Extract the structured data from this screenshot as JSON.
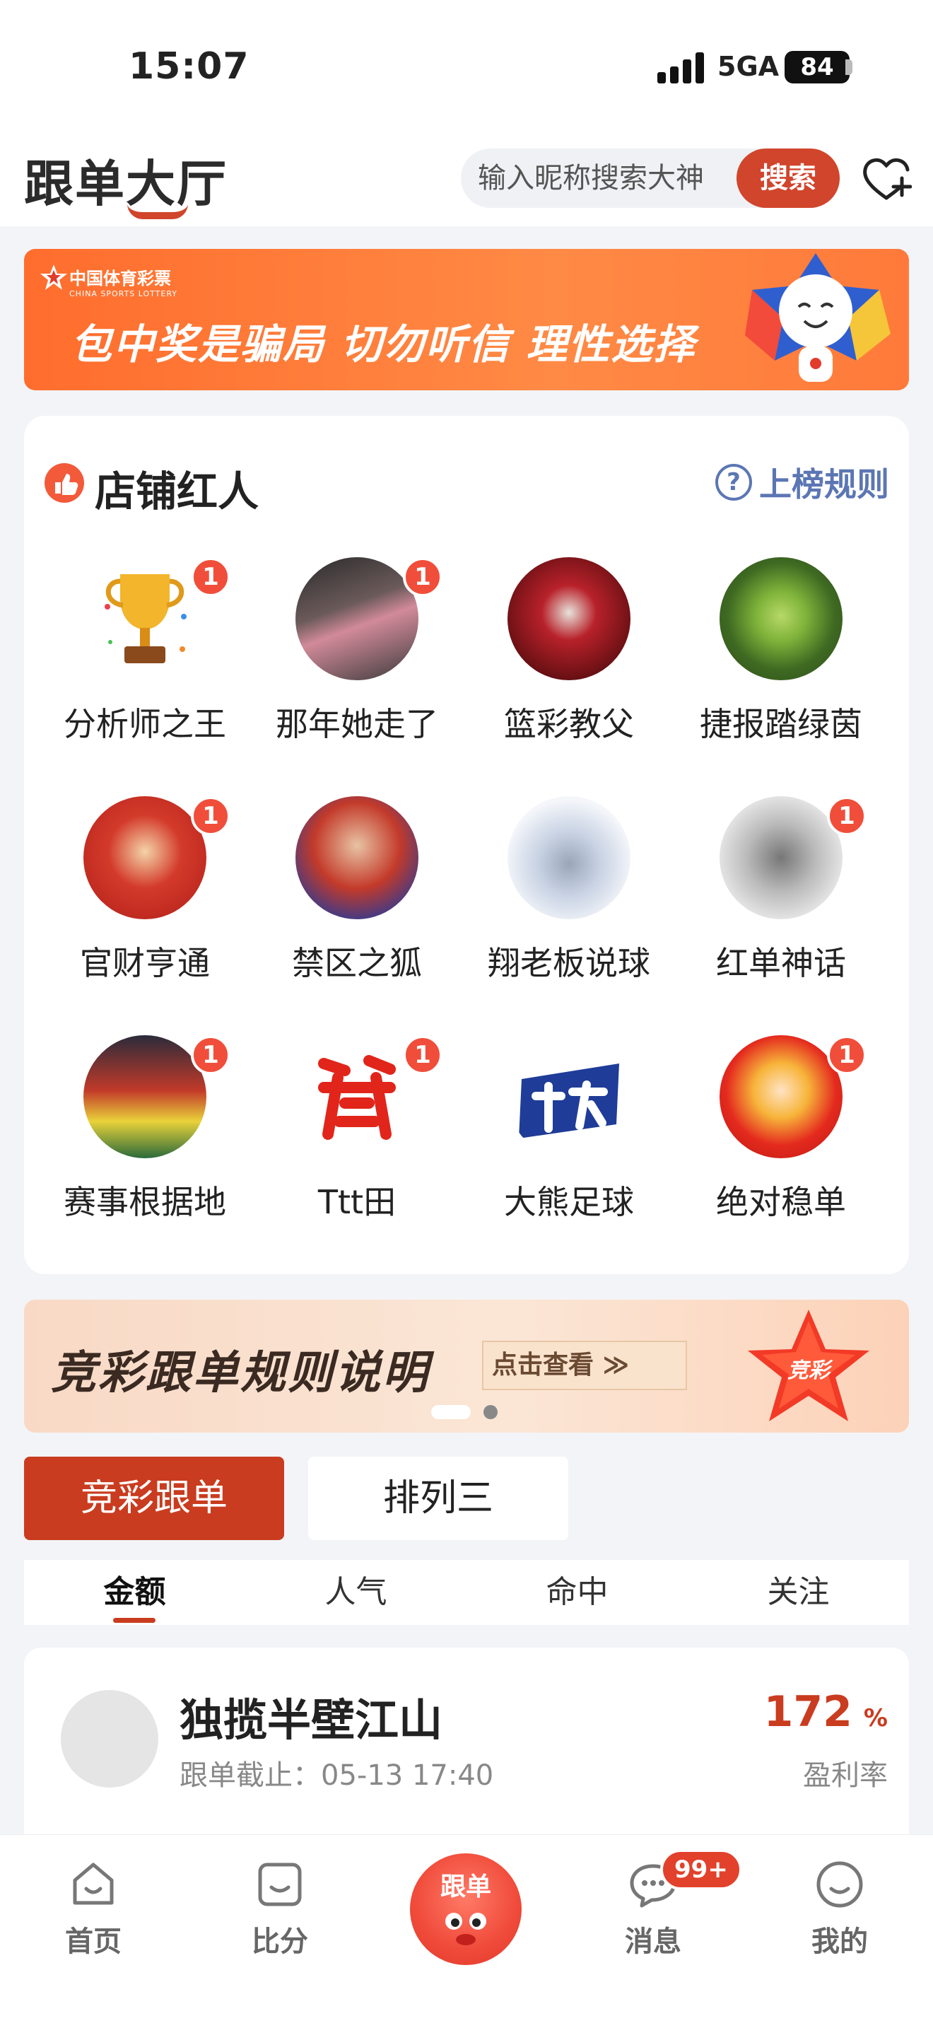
{
  "status_bar": {
    "time": "15:07",
    "network": "5GA",
    "battery": "84"
  },
  "header": {
    "title": "跟单大厅",
    "search_placeholder": "输入昵称搜索大神",
    "search_button": "搜索"
  },
  "banner_top": {
    "brand": "中国体育彩票",
    "brand_en": "CHINA SPORTS LOTTERY",
    "slogan": "包中奖是骗局 切勿听信 理性选择"
  },
  "influencers": {
    "title": "店铺红人",
    "rules_label": "上榜规则",
    "people": [
      {
        "name": "分析师之王",
        "badge": "1"
      },
      {
        "name": "那年她走了",
        "badge": "1"
      },
      {
        "name": "篮彩教父",
        "badge": ""
      },
      {
        "name": "捷报踏绿茵",
        "badge": ""
      },
      {
        "name": "官财亨通",
        "badge": "1"
      },
      {
        "name": "禁区之狐",
        "badge": ""
      },
      {
        "name": "翔老板说球",
        "badge": ""
      },
      {
        "name": "红单神话",
        "badge": "1"
      },
      {
        "name": "赛事根据地",
        "badge": "1"
      },
      {
        "name": "Ttt田",
        "badge": "1"
      },
      {
        "name": "大熊足球",
        "badge": ""
      },
      {
        "name": "绝对稳单",
        "badge": "1"
      }
    ]
  },
  "banner_rules": {
    "title": "竞彩跟单规则说明",
    "button": "点击查看 ≫",
    "star_text": "竞彩"
  },
  "category_tabs": [
    "竞彩跟单",
    "排列三"
  ],
  "sort_tabs": [
    "金额",
    "人气",
    "命中",
    "关注"
  ],
  "list": [
    {
      "name": "独揽半壁江山",
      "deadline": "跟单截止：05-13 17:40",
      "rate": "172",
      "rate_unit": "%",
      "rate_label": "盈利率"
    }
  ],
  "bottom_nav": {
    "items": [
      "首页",
      "比分",
      "跟单",
      "消息",
      "我的"
    ],
    "message_badge": "99+"
  },
  "colors": {
    "accent": "#c93c1f",
    "banner_orange": "#ff7a3a",
    "link_blue": "#5b76b3"
  }
}
